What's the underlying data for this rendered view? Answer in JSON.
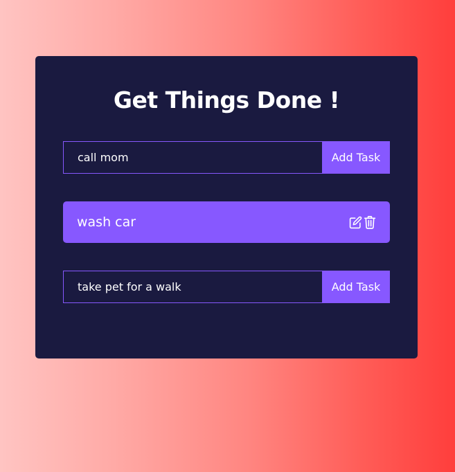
{
  "app": {
    "title": "Get Things Done !"
  },
  "new_task_form": {
    "value": "call mom",
    "button_label": "Add Task"
  },
  "todos": [
    {
      "text": "wash car",
      "actions": [
        "edit-icon",
        "trash-icon"
      ]
    }
  ],
  "edit_task_form": {
    "value": "take pet for a walk",
    "button_label": "Add Task"
  },
  "colors": {
    "panel": "#1a1a40",
    "accent": "#8758ff",
    "text": "#ffffff",
    "gradient_start": "#ffc4c2",
    "gradient_end": "#ff3e3c"
  }
}
